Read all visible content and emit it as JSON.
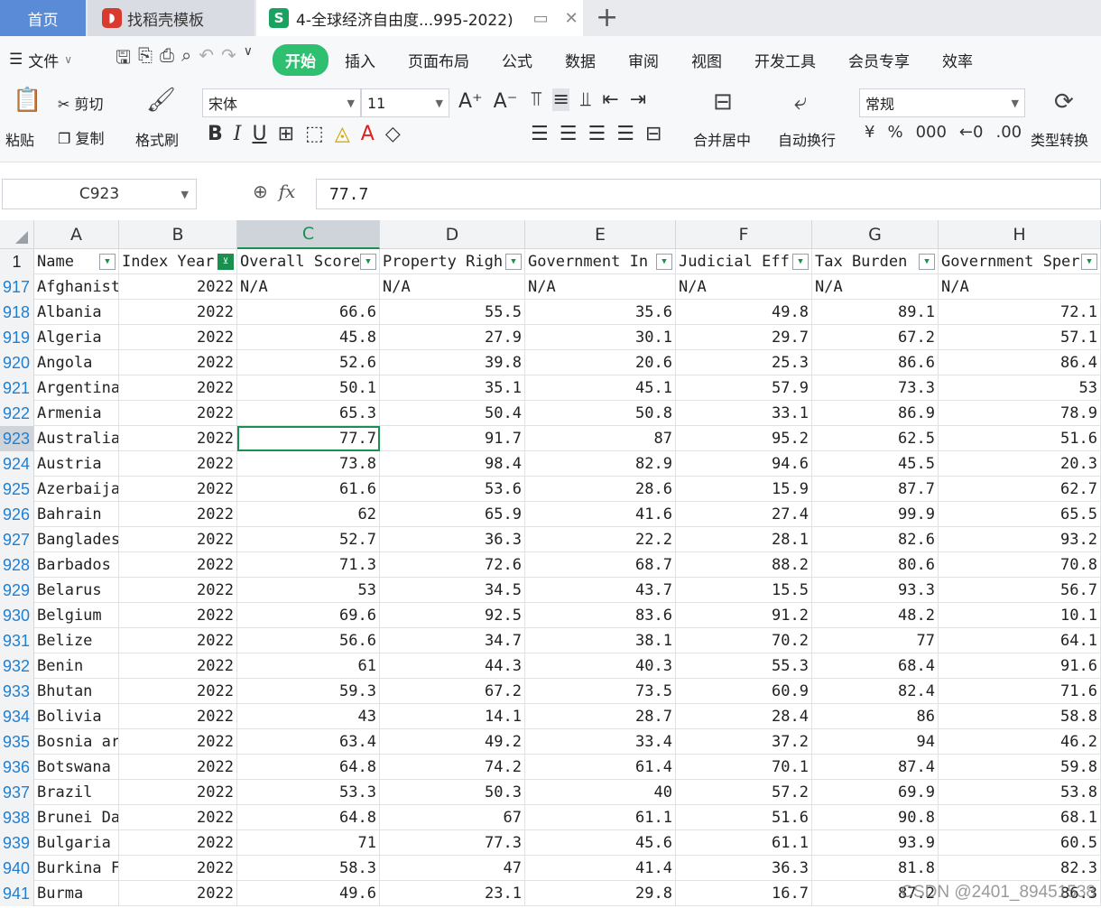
{
  "tabs": {
    "home": "首页",
    "daoke": "找稻壳模板",
    "file": "4-全球经济自由度...995-2022)"
  },
  "menu": {
    "file": "文件",
    "tabs": [
      "开始",
      "插入",
      "页面布局",
      "公式",
      "数据",
      "审阅",
      "视图",
      "开发工具",
      "会员专享",
      "效率"
    ]
  },
  "ribbon": {
    "paste": "粘贴",
    "cut": "剪切",
    "copy": "复制",
    "format_painter": "格式刷",
    "font": "宋体",
    "font_size": "11",
    "merge": "合并居中",
    "wrap": "自动换行",
    "number_format": "常规",
    "convert": "类型转换"
  },
  "formula_bar": {
    "cell_ref": "C923",
    "value": "77.7"
  },
  "columns": [
    "A",
    "B",
    "C",
    "D",
    "E",
    "F",
    "G",
    "H"
  ],
  "selected_column": "C",
  "header_row": {
    "num": "1",
    "cells": [
      "Name",
      "Index Year",
      "Overall Score",
      "Property Righ",
      "Government In",
      "Judicial Eff",
      "Tax Burden",
      "Government Sper"
    ]
  },
  "rows": [
    {
      "num": "917",
      "cells": [
        "Afghanist",
        "2022",
        "N/A",
        "N/A",
        "N/A",
        "N/A",
        "N/A",
        "N/A"
      ]
    },
    {
      "num": "918",
      "cells": [
        "Albania",
        "2022",
        "66.6",
        "55.5",
        "35.6",
        "49.8",
        "89.1",
        "72.1"
      ]
    },
    {
      "num": "919",
      "cells": [
        "Algeria",
        "2022",
        "45.8",
        "27.9",
        "30.1",
        "29.7",
        "67.2",
        "57.1"
      ]
    },
    {
      "num": "920",
      "cells": [
        "Angola",
        "2022",
        "52.6",
        "39.8",
        "20.6",
        "25.3",
        "86.6",
        "86.4"
      ]
    },
    {
      "num": "921",
      "cells": [
        "Argentina",
        "2022",
        "50.1",
        "35.1",
        "45.1",
        "57.9",
        "73.3",
        "53"
      ]
    },
    {
      "num": "922",
      "cells": [
        "Armenia",
        "2022",
        "65.3",
        "50.4",
        "50.8",
        "33.1",
        "86.9",
        "78.9"
      ]
    },
    {
      "num": "923",
      "cells": [
        "Australia",
        "2022",
        "77.7",
        "91.7",
        "87",
        "95.2",
        "62.5",
        "51.6"
      ]
    },
    {
      "num": "924",
      "cells": [
        "Austria",
        "2022",
        "73.8",
        "98.4",
        "82.9",
        "94.6",
        "45.5",
        "20.3"
      ]
    },
    {
      "num": "925",
      "cells": [
        "Azerbaija",
        "2022",
        "61.6",
        "53.6",
        "28.6",
        "15.9",
        "87.7",
        "62.7"
      ]
    },
    {
      "num": "926",
      "cells": [
        "Bahrain",
        "2022",
        "62",
        "65.9",
        "41.6",
        "27.4",
        "99.9",
        "65.5"
      ]
    },
    {
      "num": "927",
      "cells": [
        "Banglades",
        "2022",
        "52.7",
        "36.3",
        "22.2",
        "28.1",
        "82.6",
        "93.2"
      ]
    },
    {
      "num": "928",
      "cells": [
        "Barbados",
        "2022",
        "71.3",
        "72.6",
        "68.7",
        "88.2",
        "80.6",
        "70.8"
      ]
    },
    {
      "num": "929",
      "cells": [
        "Belarus",
        "2022",
        "53",
        "34.5",
        "43.7",
        "15.5",
        "93.3",
        "56.7"
      ]
    },
    {
      "num": "930",
      "cells": [
        "Belgium",
        "2022",
        "69.6",
        "92.5",
        "83.6",
        "91.2",
        "48.2",
        "10.1"
      ]
    },
    {
      "num": "931",
      "cells": [
        "Belize",
        "2022",
        "56.6",
        "34.7",
        "38.1",
        "70.2",
        "77",
        "64.1"
      ]
    },
    {
      "num": "932",
      "cells": [
        "Benin",
        "2022",
        "61",
        "44.3",
        "40.3",
        "55.3",
        "68.4",
        "91.6"
      ]
    },
    {
      "num": "933",
      "cells": [
        "Bhutan",
        "2022",
        "59.3",
        "67.2",
        "73.5",
        "60.9",
        "82.4",
        "71.6"
      ]
    },
    {
      "num": "934",
      "cells": [
        "Bolivia",
        "2022",
        "43",
        "14.1",
        "28.7",
        "28.4",
        "86",
        "58.8"
      ]
    },
    {
      "num": "935",
      "cells": [
        "Bosnia ar",
        "2022",
        "63.4",
        "49.2",
        "33.4",
        "37.2",
        "94",
        "46.2"
      ]
    },
    {
      "num": "936",
      "cells": [
        "Botswana",
        "2022",
        "64.8",
        "74.2",
        "61.4",
        "70.1",
        "87.4",
        "59.8"
      ]
    },
    {
      "num": "937",
      "cells": [
        "Brazil",
        "2022",
        "53.3",
        "50.3",
        "40",
        "57.2",
        "69.9",
        "53.8"
      ]
    },
    {
      "num": "938",
      "cells": [
        "Brunei Da",
        "2022",
        "64.8",
        "67",
        "61.1",
        "51.6",
        "90.8",
        "68.1"
      ]
    },
    {
      "num": "939",
      "cells": [
        "Bulgaria",
        "2022",
        "71",
        "77.3",
        "45.6",
        "61.1",
        "93.9",
        "60.5"
      ]
    },
    {
      "num": "940",
      "cells": [
        "Burkina F",
        "2022",
        "58.3",
        "47",
        "41.4",
        "36.3",
        "81.8",
        "82.3"
      ]
    },
    {
      "num": "941",
      "cells": [
        "Burma",
        "2022",
        "49.6",
        "23.1",
        "29.8",
        "16.7",
        "87.2",
        "86.3"
      ]
    }
  ],
  "selected_cell": {
    "row": "923",
    "col": "C"
  },
  "watermark": "CSDN @2401_89451538"
}
